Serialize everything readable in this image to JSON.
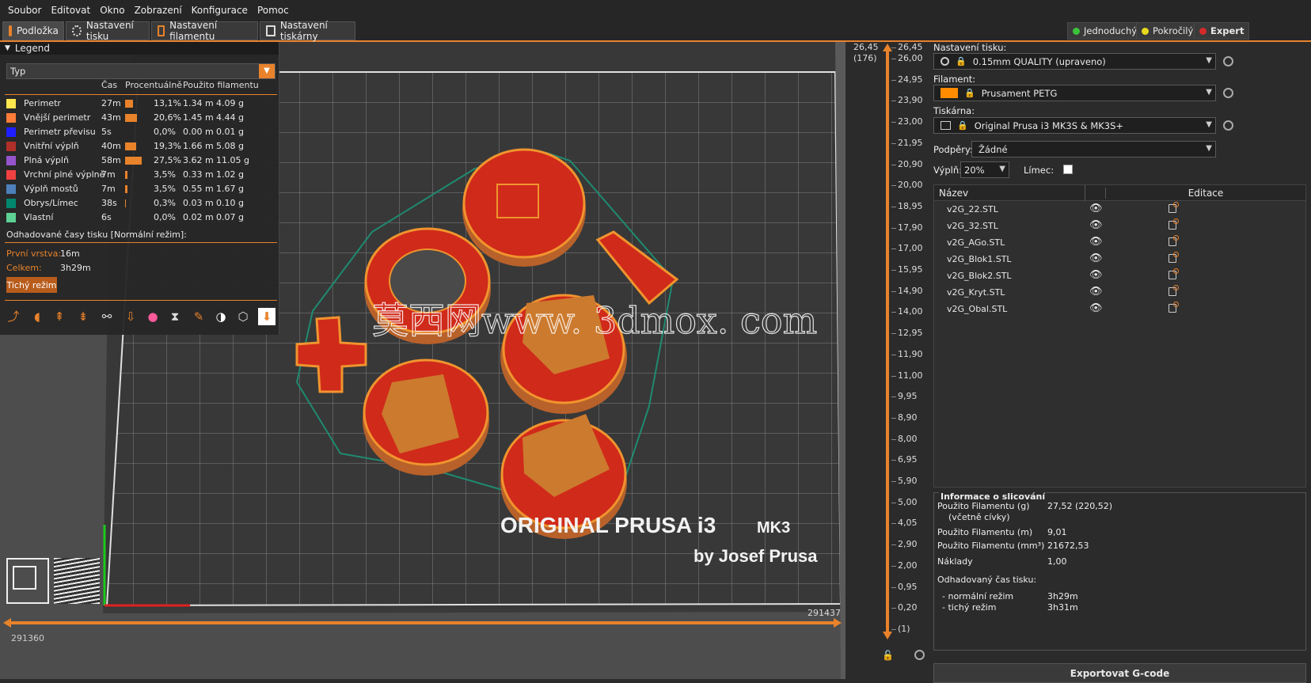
{
  "menu": [
    "Soubor",
    "Editovat",
    "Okno",
    "Zobrazení",
    "Konfigurace",
    "Pomoc"
  ],
  "tabs": [
    "Podložka",
    "Nastavení tisku",
    "Nastavení filamentu",
    "Nastavení tiskárny"
  ],
  "modes": [
    {
      "label": "Jednoduchý",
      "color": "#3cc33c"
    },
    {
      "label": "Pokročilý",
      "color": "#e8d81e"
    },
    {
      "label": "Expert",
      "color": "#d52a2a"
    }
  ],
  "legend": {
    "title": "Legend",
    "type_select": "Typ",
    "col_time": "Čas",
    "col_percent": "Procentuálně",
    "col_used": "Použito filamentu",
    "rows": [
      {
        "name": "Perimetr",
        "color": "#ffe64d",
        "time": "27m",
        "pct": "13,1%",
        "pct_value": 13.1,
        "m": "1.34 m",
        "g": "4.09 g"
      },
      {
        "name": "Vnější perimetr",
        "color": "#ff7d38",
        "time": "43m",
        "pct": "20,6%",
        "pct_value": 20.6,
        "m": "1.45 m",
        "g": "4.44 g"
      },
      {
        "name": "Perimetr převisu",
        "color": "#1f1fff",
        "time": "5s",
        "pct": "0,0%",
        "pct_value": 0.0,
        "m": "0.00 m",
        "g": "0.01 g"
      },
      {
        "name": "Vnitřní výplň",
        "color": "#b03029",
        "time": "40m",
        "pct": "19,3%",
        "pct_value": 19.3,
        "m": "1.66 m",
        "g": "5.08 g"
      },
      {
        "name": "Plná výplň",
        "color": "#9654cc",
        "time": "58m",
        "pct": "27,5%",
        "pct_value": 27.5,
        "m": "3.62 m",
        "g": "11.05 g"
      },
      {
        "name": "Vrchní plné výplně",
        "color": "#f04040",
        "time": "7m",
        "pct": "3,5%",
        "pct_value": 3.5,
        "m": "0.33 m",
        "g": "1.02 g"
      },
      {
        "name": "Výplň mostů",
        "color": "#4d80ba",
        "time": "7m",
        "pct": "3,5%",
        "pct_value": 3.5,
        "m": "0.55 m",
        "g": "1.67 g"
      },
      {
        "name": "Obrys/Límec",
        "color": "#00876e",
        "time": "38s",
        "pct": "0,3%",
        "pct_value": 0.3,
        "m": "0.03 m",
        "g": "0.10 g"
      },
      {
        "name": "Vlastní",
        "color": "#5ed194",
        "time": "6s",
        "pct": "0,0%",
        "pct_value": 0.0,
        "m": "0.02 m",
        "g": "0.07 g"
      }
    ],
    "estimate_title": "Odhadované časy tisku [Normální režim]:",
    "first_layer_label": "První vrstva:",
    "first_layer_value": "16m",
    "total_label": "Celkem:",
    "total_value": "3h29m",
    "quiet_button": "Tichý režim"
  },
  "viewport": {
    "brand_line1": "ORIGINAL PRUSA i3",
    "brand_mk": "MK3",
    "brand_line2": "by Josef Prusa",
    "watermark": "莫西网www. 3dmox. com",
    "h_left_value": "291360",
    "h_right_value": "291437"
  },
  "vslider": {
    "top_value": "26,45",
    "top_layer": "(176)",
    "ticks": [
      "26,45",
      "26,00",
      "24,95",
      "23,90",
      "23,00",
      "21,95",
      "20,90",
      "20,00",
      "18,95",
      "17,90",
      "17,00",
      "15,95",
      "14,90",
      "14,00",
      "12,95",
      "11,90",
      "11,00",
      "9,95",
      "8,90",
      "8,00",
      "6,95",
      "5,90",
      "5,00",
      "4,05",
      "2,90",
      "2,00",
      "0,95",
      "0,20",
      "(1)"
    ]
  },
  "right": {
    "print_settings_label": "Nastavení tisku:",
    "print_settings_value": "0.15mm QUALITY (upraveno)",
    "filament_label": "Filament:",
    "filament_value": "Prusament PETG",
    "filament_color": "#ff8c00",
    "printer_label": "Tiskárna:",
    "printer_value": "Original Prusa i3 MK3S & MK3S+",
    "supports_label": "Podpěry:",
    "supports_value": "Žádné",
    "infill_label": "Výplň:",
    "infill_value": "20%",
    "brim_label": "Límec:",
    "col_name": "Název",
    "col_edit": "Editace",
    "objects": [
      "v2G_22.STL",
      "v2G_32.STL",
      "v2G_AGo.STL",
      "v2G_Blok1.STL",
      "v2G_Blok2.STL",
      "v2G_Kryt.STL",
      "v2G_Obal.STL"
    ],
    "slice_info": {
      "title": "Informace o slicování",
      "rows": [
        {
          "label": "Použito Filamentu (g)",
          "sub": "(včetně cívky)",
          "value": "27,52 (220,52)"
        },
        {
          "label": "Použito Filamentu (m)",
          "value": "9,01"
        },
        {
          "label": "Použito Filamentu (mm³)",
          "value": "21672,53"
        },
        {
          "label": "Náklady",
          "value": "1,00"
        },
        {
          "label": "Odhadovaný čas tisku:",
          "value": ""
        },
        {
          "label": "- normální režim",
          "value": "3h29m"
        },
        {
          "label": "- tichý režim",
          "value": "3h31m"
        }
      ]
    },
    "export_button": "Exportovat G-code"
  }
}
